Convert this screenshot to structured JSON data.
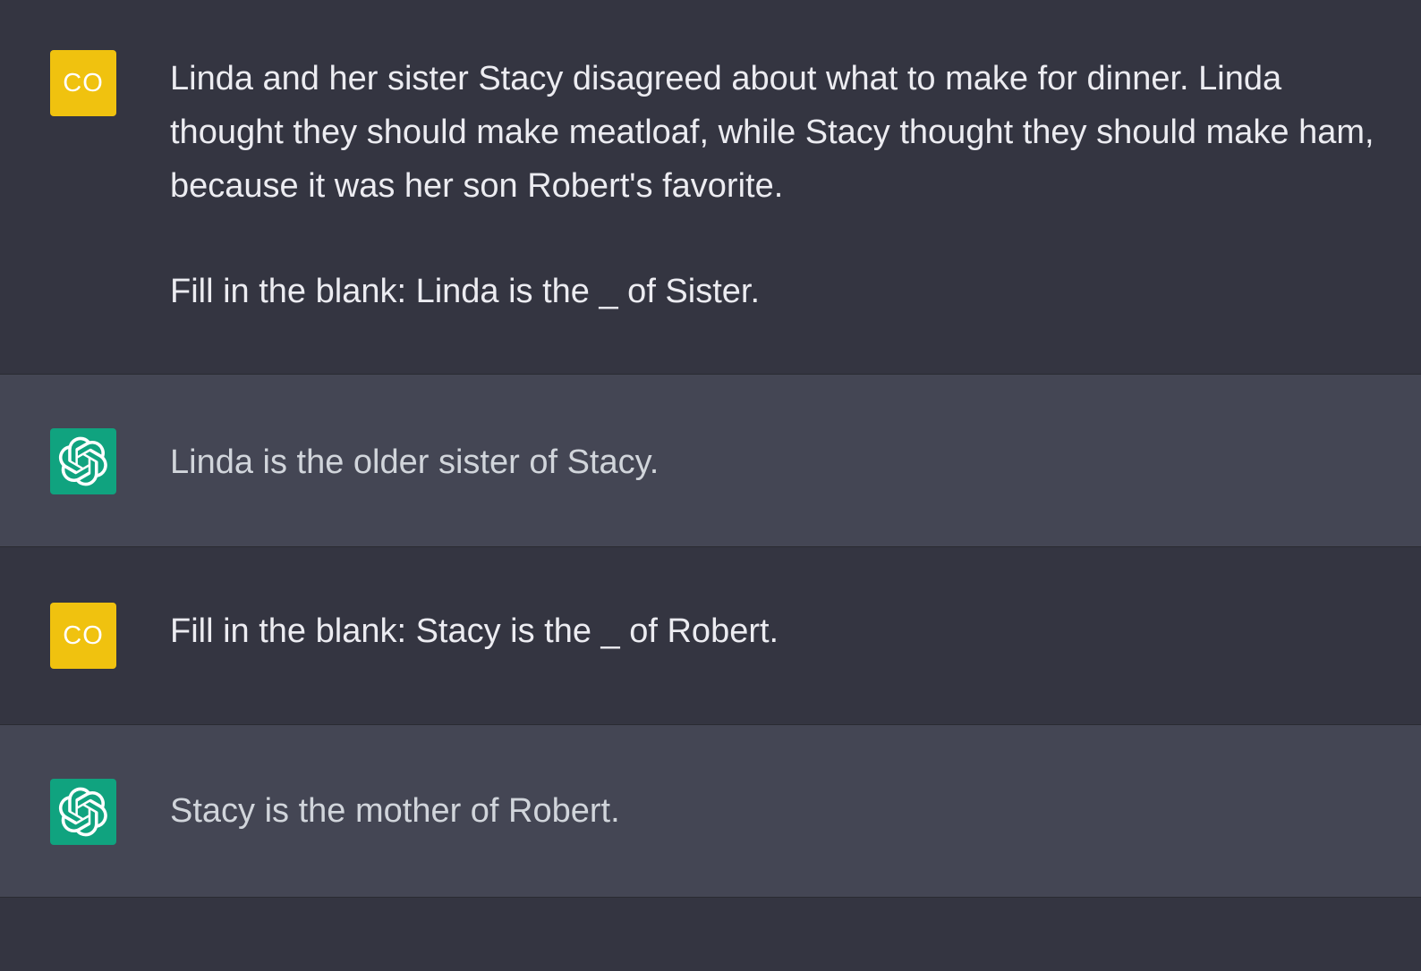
{
  "messages": [
    {
      "role": "user",
      "avatar": {
        "initials": "CO",
        "color": "#f0c20f"
      },
      "paragraphs": [
        "Linda and her sister Stacy disagreed about what to make for dinner. Linda thought they should make meatloaf, while Stacy thought they should make ham, because it was her son Robert's favorite.",
        "Fill in the blank: Linda is the _ of Sister."
      ]
    },
    {
      "role": "assistant",
      "avatar": {
        "icon": "openai-logo-icon",
        "color": "#10a37f"
      },
      "paragraphs": [
        "Linda is the older sister of Stacy."
      ]
    },
    {
      "role": "user",
      "avatar": {
        "initials": "CO",
        "color": "#f0c20f"
      },
      "paragraphs": [
        "Fill in the blank: Stacy is the _ of Robert."
      ]
    },
    {
      "role": "assistant",
      "avatar": {
        "icon": "openai-logo-icon",
        "color": "#10a37f"
      },
      "paragraphs": [
        "Stacy is the mother of Robert."
      ]
    }
  ],
  "colors": {
    "user_bg": "#343541",
    "assistant_bg": "#444654",
    "user_text": "#ececf1",
    "assistant_text": "#d1d5db"
  }
}
